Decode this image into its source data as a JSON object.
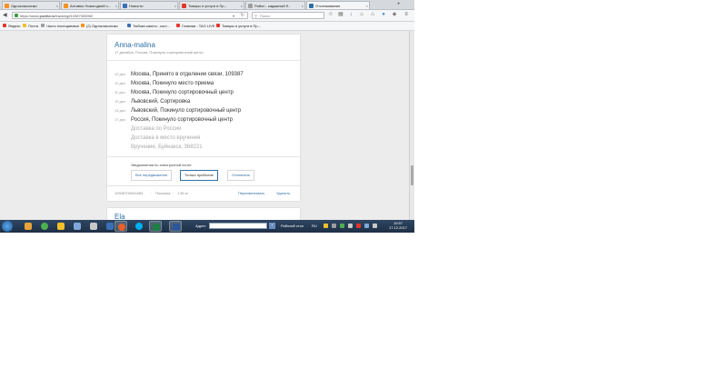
{
  "tabs": [
    {
      "title": "Одноклассники",
      "color": "#f7931e"
    },
    {
      "title": "Антивио Новогодний с...",
      "color": "#f7931e"
    },
    {
      "title": "Новости",
      "color": "#3b6fb6"
    },
    {
      "title": "Товары и услуги в Пр...",
      "color": "#e3352c"
    },
    {
      "title": "Район - каджиный б...",
      "color": "#9e9e9e"
    },
    {
      "title": "Отслеживание",
      "color": "#2f6fa7"
    }
  ],
  "url": {
    "prefix": "https://www.",
    "host": "pochta.ru",
    "path": "/tracking#10387053960"
  },
  "search_placeholder": "Поиск",
  "bookmarks": [
    {
      "label": "Яндекс",
      "color": "#e3352c"
    },
    {
      "label": "Почта",
      "color": "#f2c029"
    },
    {
      "label": "Часто посещаемые",
      "color": "#9e9e9e"
    },
    {
      "label": "(2) Одноклассники",
      "color": "#f7931e"
    },
    {
      "label": "Тюбики каюты - кост...",
      "color": "#3b6fb6"
    },
    {
      "label": "Главная - TAO LIVE",
      "color": "#e3352c"
    },
    {
      "label": "Товары и услуги в Пр...",
      "color": "#e3352c"
    }
  ],
  "card": {
    "title": "Anna-malina",
    "subtitle": "17 декабря, Россия, Покинуло сортировочный центр",
    "events": [
      {
        "date": "10 дек",
        "text": "Москва, Принято в отделении связи, 109387"
      },
      {
        "date": "10 дек",
        "text": "Москва, Покинуло место приема"
      },
      {
        "date": "11 дек",
        "text": "Москва, Покинуло сортировочный центр"
      },
      {
        "date": "13 дек",
        "text": "Львовский, Сортировка"
      },
      {
        "date": "13 дек",
        "text": "Львовский, Покинуло сортировочный центр"
      },
      {
        "date": "17 дек",
        "text": "Россия, Покинуло сортировочный центр"
      }
    ],
    "future": [
      "Доставка по России",
      "Доставка в место вручения",
      "Вручение, Буйнакск, 368221"
    ],
    "notice": "Уведомления по электронной почте",
    "options": [
      "Все передвижения",
      "Только прибытие",
      "Отключить"
    ],
    "selected_option": "Только прибытие",
    "footer": {
      "track": "10938705341863",
      "sep": "·",
      "type": "Посылка",
      "weight": "1.80 кг",
      "rename": "Переименовать",
      "delete": "Удалить"
    }
  },
  "card2": {
    "title": "Ela"
  },
  "taskbar": {
    "address_label": "Адрес",
    "desktop_label": "Рабочий стол",
    "lang": "RU",
    "time": "10:57",
    "date": "17.12.2017"
  },
  "colors": {
    "accent": "#2f6fa7",
    "taskbar": "#1d2f45"
  }
}
